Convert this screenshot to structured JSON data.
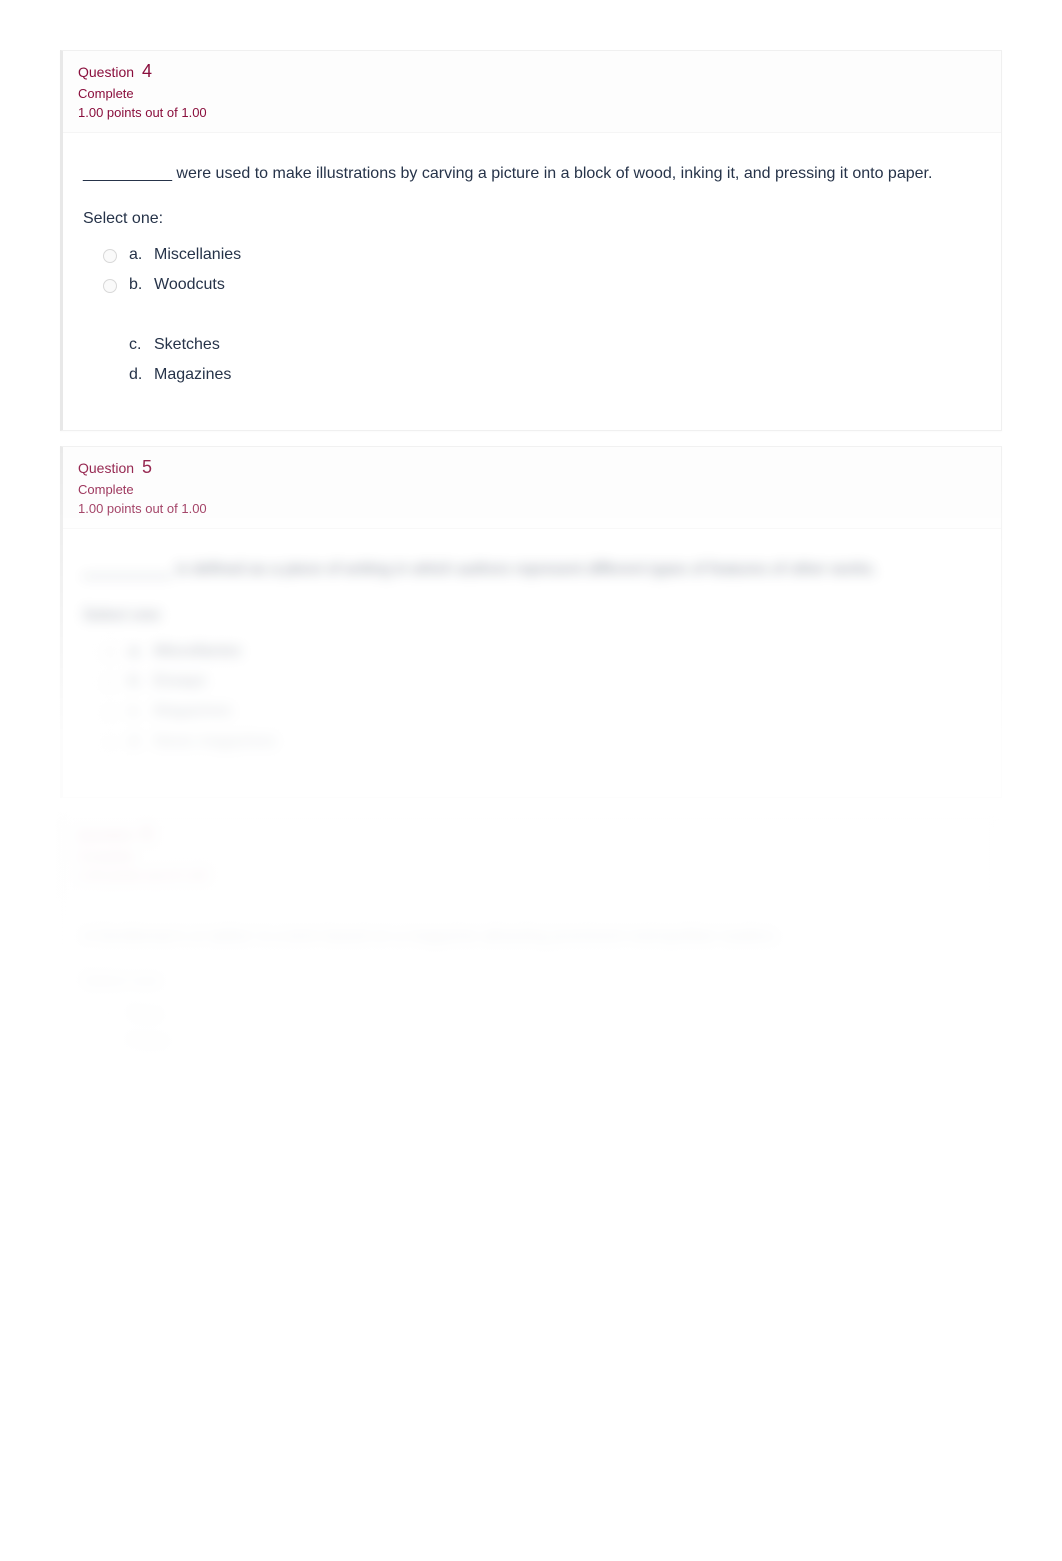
{
  "questions": [
    {
      "label": "Question",
      "number": "4",
      "status": "Complete",
      "points": "1.00 points out of 1.00",
      "text": "__________ were used to make illustrations by carving a picture in a block of wood, inking it, and pressing it onto paper.",
      "select_one": "Select one:",
      "options": [
        {
          "letter": "a.",
          "text": "Miscellanies"
        },
        {
          "letter": "b.",
          "text": "Woodcuts"
        },
        {
          "letter": "c.",
          "text": "Sketches"
        },
        {
          "letter": "d.",
          "text": "Magazines"
        }
      ]
    },
    {
      "label": "Question",
      "number": "5",
      "status": "Complete",
      "points": "1.00 points out of 1.00",
      "text": "__________ is defined as a piece of writing in which authors represent different types of features of other works.",
      "select_one": "Select one:",
      "options": [
        {
          "letter": "a.",
          "text": "Miscellanies"
        },
        {
          "letter": "b.",
          "text": "Essays"
        },
        {
          "letter": "c.",
          "text": "Magazines"
        },
        {
          "letter": "d.",
          "text": "News magazines"
        }
      ]
    },
    {
      "label": "Question",
      "number": "6",
      "status": "Complete",
      "points": "1.00 points out of 1.00",
      "text": "A Gentleman's or ladies' is a term based on a magazine attracting prominent metropolitan readers.",
      "select_one": "Select one:",
      "options": [
        {
          "text": "True"
        },
        {
          "text": "False"
        }
      ]
    }
  ]
}
